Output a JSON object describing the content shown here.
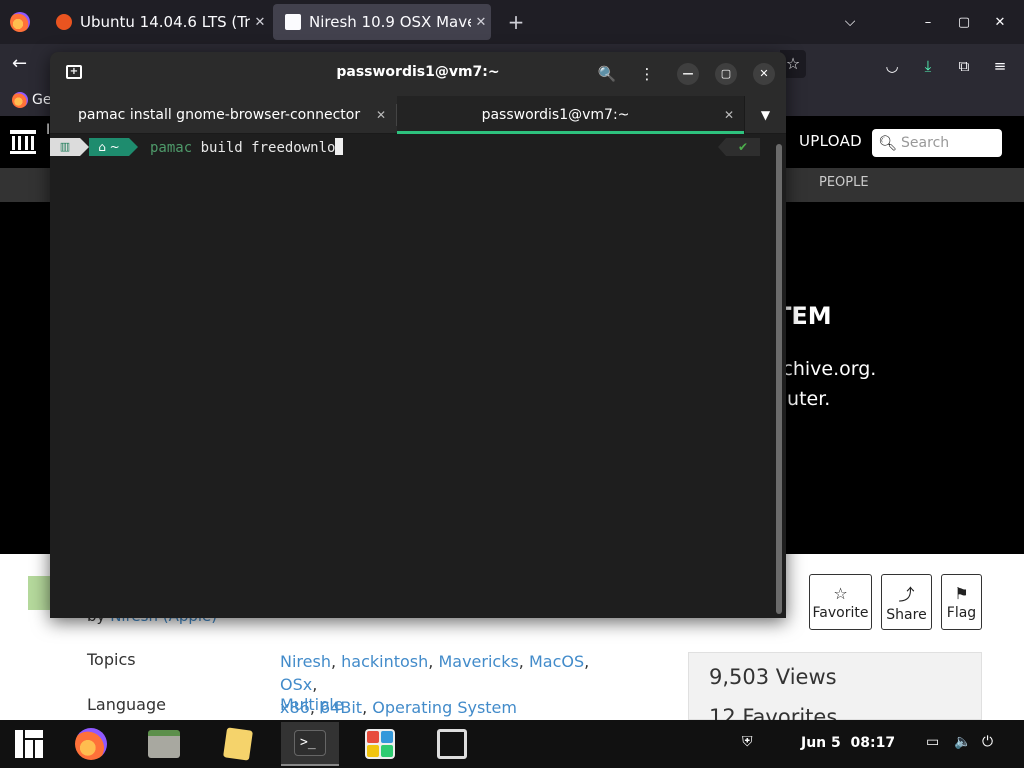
{
  "browser": {
    "tabs": [
      {
        "title": "Ubuntu 14.04.6 LTS (Tru",
        "close": "✕"
      },
      {
        "title": "Niresh 10.9 OSX Maveric",
        "close": "✕"
      }
    ],
    "new_tab": "+",
    "list_tabs": "⌵",
    "controls": {
      "min": "–",
      "max": "▢",
      "close": "✕"
    },
    "nav": {
      "back": "←",
      "bookmark": "☆",
      "pocket": "◡",
      "download": "⤓",
      "extensions": "⧉",
      "menu": "≡"
    },
    "bookmark_partial": "Ge"
  },
  "page": {
    "logo_partial": "I",
    "upload": "UPLOAD",
    "search_placeholder": "Search",
    "people": "PEOPLE",
    "banner_heading": "TEM",
    "banner_line1": "rchive.org.",
    "banner_line2": "puter.",
    "by_prefix": "by",
    "by_author": "Niresh (Apple)",
    "actions": [
      {
        "icon": "☆",
        "label": "Favorite"
      },
      {
        "icon": "⤴",
        "label": "Share"
      },
      {
        "icon": "⚑",
        "label": "Flag"
      }
    ],
    "topics_label": "Topics",
    "topics": [
      "Niresh",
      "hackintosh",
      "Mavericks",
      "MacOS",
      "OSx",
      "x86",
      "64Bit",
      "Operating System"
    ],
    "language_label": "Language",
    "language": "Multiple",
    "views": "9,503 Views",
    "favorites": "12 Favorites"
  },
  "terminal": {
    "title": "passwordis1@vm7:~",
    "tabs": [
      {
        "label": "pamac install gnome-browser-connector",
        "close": "✕",
        "active": false
      },
      {
        "label": "passwordis1@vm7:~",
        "close": "✕",
        "active": true
      }
    ],
    "tab_dropdown": "▼",
    "prompt_dir": "⌂ ~",
    "prompt_os": "▥",
    "command_prog": "pamac",
    "command_rest": " build freedownlo",
    "status": "✔",
    "icons": {
      "search": "🔍",
      "menu": "⋮",
      "min": "—",
      "max": "▢",
      "close": "✕",
      "newtab": "+"
    }
  },
  "taskbar": {
    "apps": [
      "Menu",
      "Firefox",
      "Files",
      "Text Editor",
      "Terminal",
      "Software",
      "Screenshot"
    ],
    "active_app": "Terminal",
    "date": "Jun 5",
    "time": "08:17",
    "tray": {
      "shield": "⛨",
      "display": "▭",
      "volume": "🔈",
      "power": "⏻"
    }
  }
}
